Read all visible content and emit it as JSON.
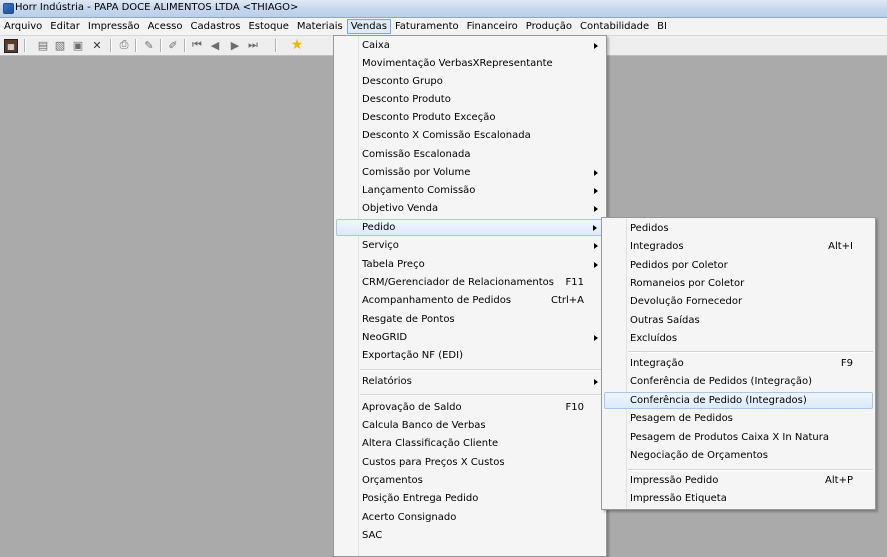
{
  "window": {
    "title": "Horr Indústria - PAPA DOCE ALIMENTOS LTDA <THIAGO>"
  },
  "menubar": {
    "items": [
      "Arquivo",
      "Editar",
      "Impressão",
      "Acesso",
      "Cadastros",
      "Estoque",
      "Materiais",
      "Vendas",
      "Faturamento",
      "Financeiro",
      "Produção",
      "Contabilidade",
      "BI"
    ],
    "active": "Vendas"
  },
  "toolbar": {
    "icons": [
      "report-icon",
      "preview-icon",
      "print-preview-icon",
      "save-icon",
      "delete-icon",
      "print-icon",
      "edit-icon",
      "tool-icon",
      "first-record-icon",
      "previous-record-icon",
      "next-record-icon",
      "last-record-icon",
      "favorite-star-icon"
    ]
  },
  "vendas_menu": {
    "items": [
      {
        "label": "Caixa",
        "submenu": true
      },
      {
        "label": "Movimentação VerbasXRepresentante"
      },
      {
        "label": "Desconto Grupo"
      },
      {
        "label": "Desconto Produto"
      },
      {
        "label": "Desconto Produto Exceção"
      },
      {
        "label": "Desconto X Comissão Escalonada"
      },
      {
        "label": "Comissão Escalonada"
      },
      {
        "label": "Comissão por Volume",
        "submenu": true
      },
      {
        "label": "Lançamento Comissão",
        "submenu": true
      },
      {
        "label": "Objetivo Venda",
        "submenu": true
      },
      {
        "label": "Pedido",
        "submenu": true,
        "highlighted": true
      },
      {
        "label": "Serviço",
        "submenu": true
      },
      {
        "label": "Tabela Preço",
        "submenu": true
      },
      {
        "label": "CRM/Gerenciador de Relacionamentos",
        "shortcut": "F11"
      },
      {
        "label": "Acompanhamento de Pedidos",
        "shortcut": "Ctrl+A"
      },
      {
        "label": "Resgate de Pontos"
      },
      {
        "label": "NeoGRID",
        "submenu": true
      },
      {
        "label": "Exportação NF (EDI)"
      },
      {
        "label": "Relatórios",
        "submenu": true
      },
      {
        "label": "Aprovação de Saldo",
        "shortcut": "F10"
      },
      {
        "label": "Calcula Banco de Verbas"
      },
      {
        "label": "Altera Classificação Cliente"
      },
      {
        "label": "Custos para Preços X Custos"
      },
      {
        "label": "Orçamentos"
      },
      {
        "label": "Posição Entrega Pedido"
      },
      {
        "label": "Acerto Consignado"
      },
      {
        "label": "SAC"
      }
    ]
  },
  "pedido_submenu": {
    "items": [
      {
        "label": "Pedidos"
      },
      {
        "label": "Integrados",
        "shortcut": "Alt+I"
      },
      {
        "label": "Pedidos por Coletor"
      },
      {
        "label": "Romaneios por Coletor"
      },
      {
        "label": "Devolução Fornecedor"
      },
      {
        "label": "Outras Saídas"
      },
      {
        "label": "Excluídos"
      },
      {
        "label": "Integração",
        "shortcut": "F9"
      },
      {
        "label": "Conferência de Pedidos (Integração)"
      },
      {
        "label": "Conferência de Pedido (Integrados)",
        "highlighted": true
      },
      {
        "label": "Pesagem de Pedidos"
      },
      {
        "label": "Pesagem de Produtos Caixa X In Natura"
      },
      {
        "label": "Negociação de Orçamentos"
      },
      {
        "label": "Impressão Pedido",
        "shortcut": "Alt+P"
      },
      {
        "label": "Impressão Etiqueta"
      }
    ]
  }
}
